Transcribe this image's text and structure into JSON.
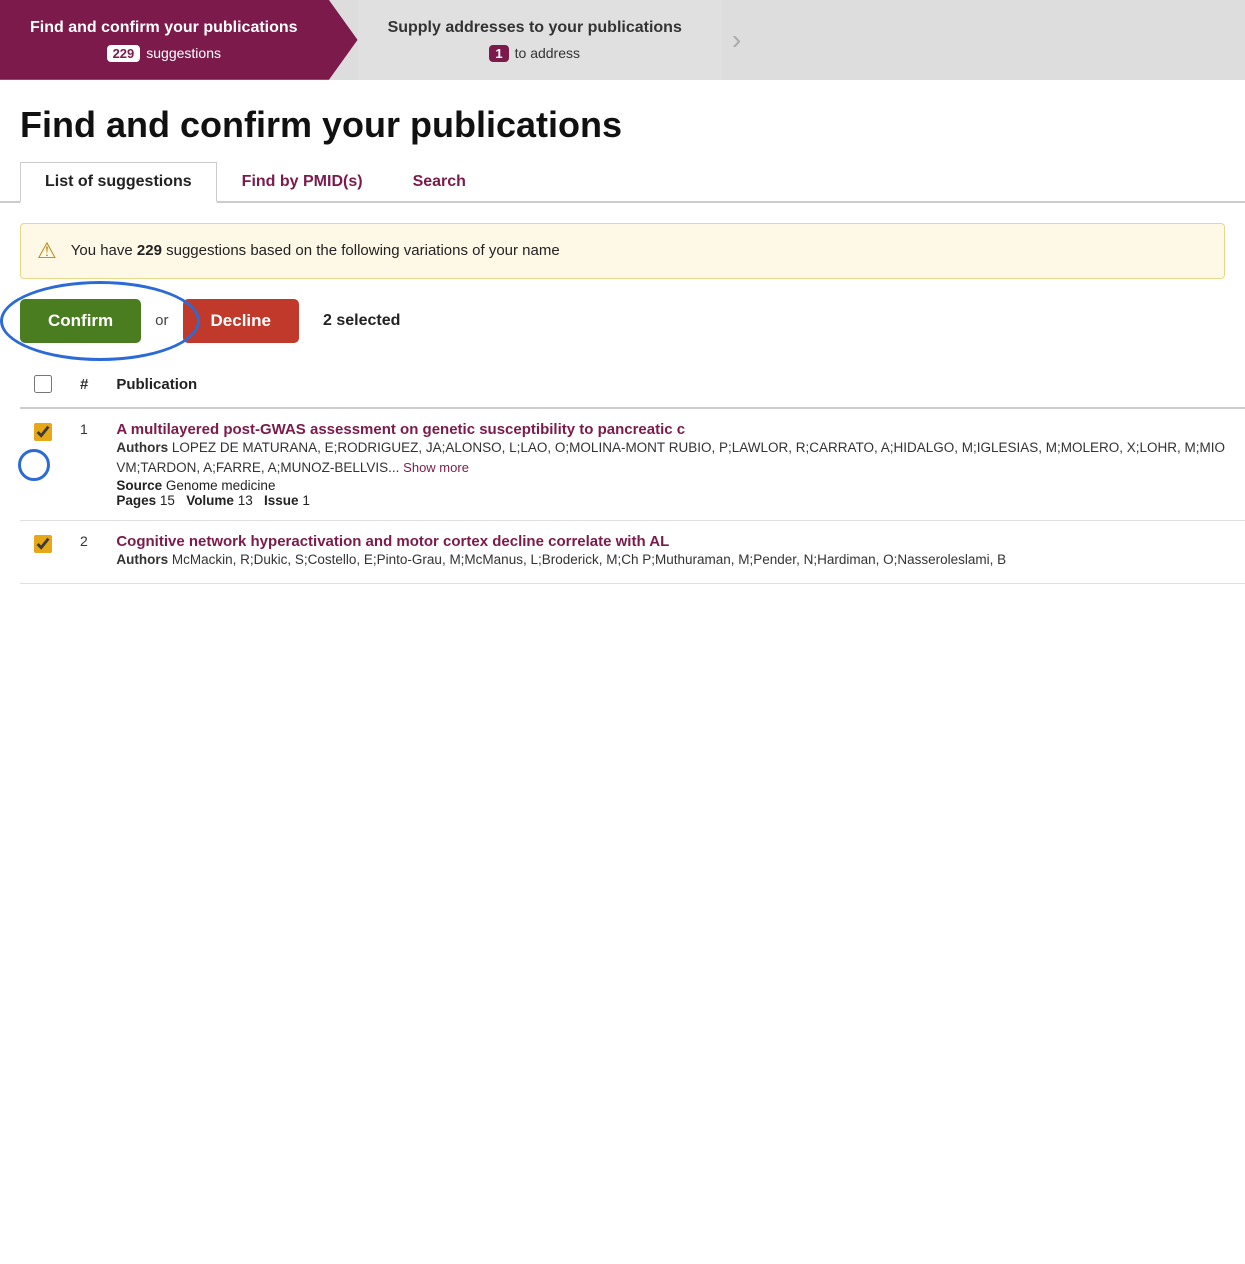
{
  "wizard": {
    "step1": {
      "title": "Find and confirm your publications",
      "suggestions_count": "229",
      "suggestions_label": "suggestions",
      "active": true
    },
    "step2": {
      "title": "Supply addresses to your publications",
      "to_address_count": "1",
      "to_address_label": "to address",
      "active": false
    }
  },
  "page": {
    "title": "Find and confirm your publications"
  },
  "tabs": [
    {
      "id": "list-of-suggestions",
      "label": "List of suggestions",
      "active": true
    },
    {
      "id": "find-by-pmid",
      "label": "Find by PMID(s)",
      "active": false
    },
    {
      "id": "search",
      "label": "Search",
      "active": false
    }
  ],
  "info": {
    "message_prefix": "You have ",
    "count": "229",
    "message_suffix": " suggestions based on the following variations of your name"
  },
  "actions": {
    "confirm_label": "Confirm",
    "or_text": "or",
    "decline_label": "Decline",
    "selected_text": "2 selected"
  },
  "table": {
    "headers": [
      "",
      "#",
      "Publication"
    ],
    "rows": [
      {
        "num": "1",
        "title": "A multilayered post-GWAS assessment on genetic susceptibility to pancreatic c",
        "authors_label": "Authors",
        "authors": "LOPEZ DE MATURANA, E;RODRIGUEZ, JA;ALONSO, L;LAO, O;MOLINA-MONT RUBIO, P;LAWLOR, R;CARRATO, A;HIDALGO, M;IGLESIAS, M;MOLERO, X;LOHR, M;MIO VM;TARDON, A;FARRE, A;MUNOZ-BELLVIS...",
        "show_more": "Show more",
        "source_label": "Source",
        "source": "Genome medicine",
        "pages_label": "Pages",
        "pages": "15",
        "volume_label": "Volume",
        "volume": "13",
        "issue_label": "Issue",
        "issue": "1",
        "checked": true
      },
      {
        "num": "2",
        "title": "Cognitive network hyperactivation and motor cortex decline correlate with AL",
        "authors_label": "Authors",
        "authors": "McMackin, R;Dukic, S;Costello, E;Pinto-Grau, M;McManus, L;Broderick, M;Ch P;Muthuraman, M;Pender, N;Hardiman, O;Nasseroleslami, B",
        "show_more": "",
        "source_label": "",
        "source": "",
        "pages_label": "",
        "pages": "",
        "volume_label": "",
        "volume": "",
        "issue_label": "",
        "issue": "",
        "checked": true
      }
    ]
  }
}
